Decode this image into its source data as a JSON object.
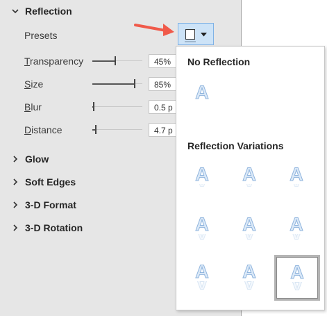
{
  "pane": {
    "reflection_heading": "Reflection",
    "presets_label": "Presets",
    "rows": [
      {
        "label_ul": "T",
        "label_rest": "ransparency",
        "value": "45%",
        "level": 0.45
      },
      {
        "label_ul": "S",
        "label_rest": "ize",
        "value": "85%",
        "level": 0.85
      },
      {
        "label_ul": "B",
        "label_rest": "lur",
        "value": "0.5 p",
        "level": 0.01
      },
      {
        "label_ul": "D",
        "label_rest": "istance",
        "value": "4.7 p",
        "level": 0.05
      }
    ],
    "sections": [
      {
        "label": "Glow"
      },
      {
        "label": "Soft Edges"
      },
      {
        "label": "3-D Format"
      },
      {
        "label": "3-D Rotation"
      }
    ]
  },
  "gallery": {
    "no_reflection_title": "No Reflection",
    "variations_title": "Reflection Variations",
    "glyph": "A",
    "selected_index": 8
  },
  "colors": {
    "pane_bg": "#e6e6e6",
    "accent": "#cde3f7",
    "arrow": "#f05a4a"
  }
}
